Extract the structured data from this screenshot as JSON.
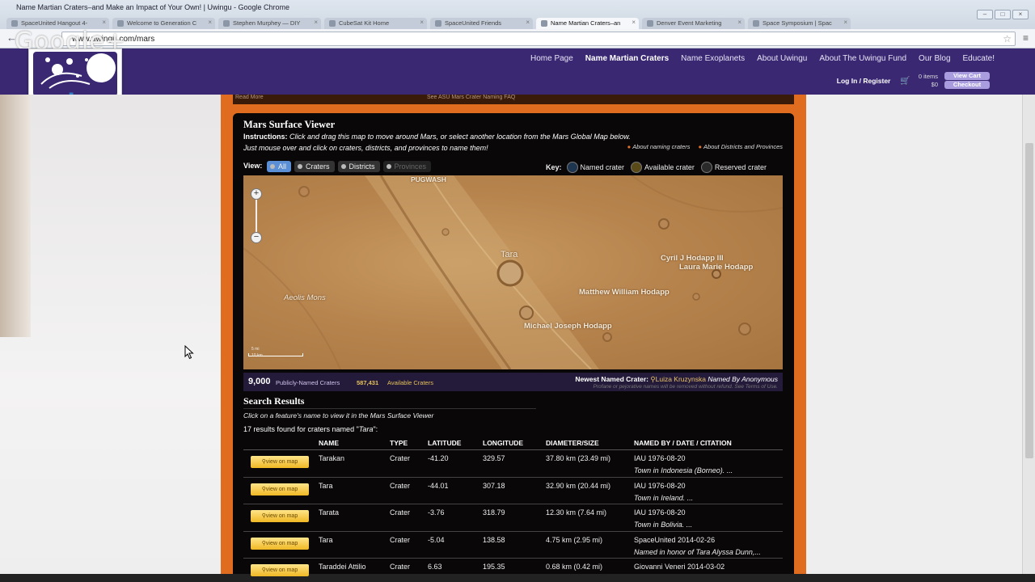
{
  "window": {
    "title": "Name Martian Craters–and Make an Impact of Your Own! | Uwingu - Google Chrome",
    "controls": [
      "–",
      "□",
      "×"
    ]
  },
  "tabs": [
    {
      "label": "SpaceUnited Hangout 4-"
    },
    {
      "label": "Welcome to Generation C"
    },
    {
      "label": "Stephen Murphey — DIY"
    },
    {
      "label": "CubeSat Kit Home"
    },
    {
      "label": "SpaceUnited Friends"
    },
    {
      "label": "Name Martian Craters–an"
    },
    {
      "label": "Denver Event Marketing"
    },
    {
      "label": "Space Symposium | Spac"
    }
  ],
  "active_tab_index": 5,
  "address_bar": {
    "url": "www.uwingu.com/mars"
  },
  "overlay_brand": "Google+",
  "site": {
    "logo_text": "uwingu",
    "nav": [
      "Home Page",
      "Name Martian Craters",
      "Name Exoplanets",
      "About Uwingu",
      "About The Uwingu Fund",
      "Our Blog",
      "Educate!"
    ],
    "active_nav_index": 1,
    "login": "Log In / Register",
    "cart_items": "0 items",
    "cart_total": "$0",
    "view_cart": "View Cart",
    "checkout": "Checkout",
    "read_more": "Read More",
    "top_link": "See ASU Mars Crater Naming FAQ"
  },
  "viewer": {
    "title": "Mars Surface Viewer",
    "instructions_label": "Instructions:",
    "instructions_1": "Click and drag this map to move around Mars, or select another location from the Mars Global Map below.",
    "instructions_2": "Just mouse over and click on craters, districts, and provinces to name them!",
    "link_about_naming": "About naming craters",
    "link_about_districts": "About Districts and Provinces",
    "view_label": "View:",
    "view_buttons": [
      "All",
      "Craters",
      "Districts",
      "Provinces"
    ],
    "key_label": "Key:",
    "key_items": [
      {
        "label": "Named crater",
        "color": "#1e3550"
      },
      {
        "label": "Available crater",
        "color": "#5a4a18"
      },
      {
        "label": "Reserved crater",
        "color": "#2a2a2a"
      }
    ],
    "map_labels": {
      "pugwash": "PUGWASH",
      "tara": "Tara",
      "cyril": "Cyril J Hodapp III",
      "laura": "Laura Marie Hodapp",
      "matthew": "Matthew William Hodapp",
      "michael": "Michael Joseph Hodapp",
      "aeolis": "Aeolis Mons"
    },
    "scale_top": "5 mi",
    "scale_bottom": "10 km",
    "zoom_in": "+",
    "zoom_out": "−"
  },
  "stats": {
    "named_count": "9,000",
    "named_label": "Publicly-Named Craters",
    "available_count": "587,431",
    "available_label": "Available Craters",
    "newest_label": "Newest Named Crater:",
    "newest_name": "Luiza Kruzynska",
    "newest_by": "Named By Anonymous",
    "newest_note": "Profane or pejorative names will be removed without refund. See Terms of Use."
  },
  "results": {
    "title": "Search Results",
    "hint": "Click on a feature's name to view it in the Mars Surface Viewer",
    "count_prefix": "17 results found for craters named \"",
    "query": "Tara",
    "count_suffix": "\":",
    "headers": [
      "",
      "NAME",
      "TYPE",
      "LATITUDE",
      "LONGITUDE",
      "DIAMETER/SIZE",
      "NAMED BY / DATE / CITATION"
    ],
    "button_label": "view on map",
    "rows": [
      {
        "name": "Tarakan",
        "type": "Crater",
        "lat": "-41.20",
        "lon": "329.57",
        "diam": "37.80 km (23.49 mi)",
        "by": "IAU 1976-08-20",
        "note": "Town in Indonesia (Borneo). ..."
      },
      {
        "name": "Tara",
        "type": "Crater",
        "lat": "-44.01",
        "lon": "307.18",
        "diam": "32.90 km (20.44 mi)",
        "by": "IAU 1976-08-20",
        "note": "Town in Ireland. ..."
      },
      {
        "name": "Tarata",
        "type": "Crater",
        "lat": "-3.76",
        "lon": "318.79",
        "diam": "12.30 km (7.64 mi)",
        "by": "IAU 1976-08-20",
        "note": "Town in Bolivia. ..."
      },
      {
        "name": "Tara",
        "type": "Crater",
        "lat": "-5.04",
        "lon": "138.58",
        "diam": "4.75 km (2.95 mi)",
        "by": "SpaceUnited 2014-02-26",
        "note": "Named in honor of Tara Alyssa Dunn,..."
      },
      {
        "name": "Taraddei Attilio",
        "type": "Crater",
        "lat": "6.63",
        "lon": "195.35",
        "diam": "0.68 km (0.42 mi)",
        "by": "Giovanni Veneri 2014-03-02",
        "note": ""
      }
    ]
  }
}
